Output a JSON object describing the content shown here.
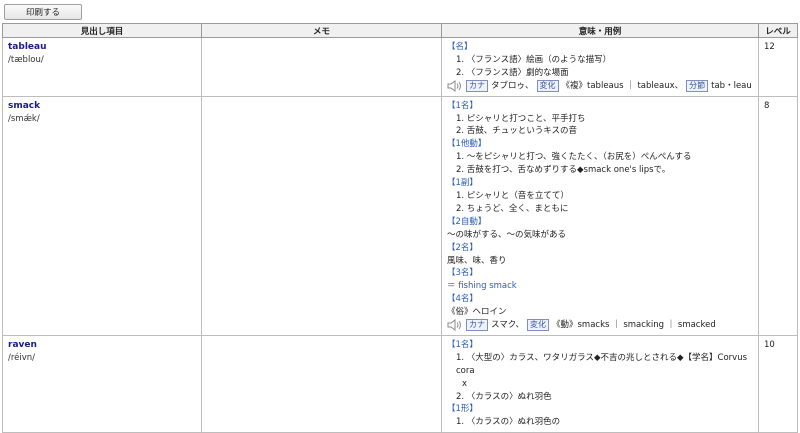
{
  "toolbar": {
    "print_label": "印刷する"
  },
  "columns": {
    "headword": "見出し項目",
    "memo": "メモ",
    "meaning": "意味・用例",
    "level": "レベル"
  },
  "entries": [
    {
      "word": "tableau",
      "pron": "/tæblou/",
      "level": "12",
      "pos1": "【名】",
      "m1": "1. 〈フランス語〉絵画（のような描写）",
      "m2": "2. 〈フランス語〉劇的な場面",
      "kana_tag": "カナ",
      "kana": "タブロゥ、",
      "henka_tag": "変化",
      "henka": "《複》tableaus ｜ tableaux、",
      "bunsetsu_tag": "分節",
      "bunsetsu": "tab・leau"
    },
    {
      "word": "smack",
      "pron": "/smǽk/",
      "level": "8",
      "pos1": "【1名】",
      "m1": "1. ピシャリと打つこと、平手打ち",
      "m2": "2. 舌鼓、チュッというキスの音",
      "pos2": "【1他動】",
      "m3": "1. ～をピシャリと打つ、強くたたく、（お尻を）ぺんぺんする",
      "m4": "2. 舌鼓を打つ、舌なめずりする◆smack one's lipsで。",
      "pos3": "【1副】",
      "m5": "1. ピシャリと（音を立てて）",
      "m6": "2. ちょうど、全く、まともに",
      "pos4": "【2自動】",
      "m7": "～の味がする、～の気味がある",
      "pos5": "【2名】",
      "m8": "風味、味、香り",
      "pos6": "【3名】",
      "m9": "＝ fishing smack",
      "pos7": "【4名】",
      "m10": "《俗》ヘロイン",
      "kana_tag": "カナ",
      "kana": "スマク、",
      "henka_tag": "変化",
      "henka": "《動》smacks ｜ smacking ｜ smacked"
    },
    {
      "word": "raven",
      "pron": "/réivn/",
      "level": "10",
      "pos1": "【1名】",
      "m1": "1. 〈大型の〉カラス、ワタリガラス◆不吉の兆しとされる◆【学名】Corvus cora",
      "m1b": "x",
      "m2": "2. 〈カラスの〉ぬれ羽色",
      "pos2": "【1形】",
      "m3": "1. 〈カラスの〉ぬれ羽色の"
    }
  ]
}
